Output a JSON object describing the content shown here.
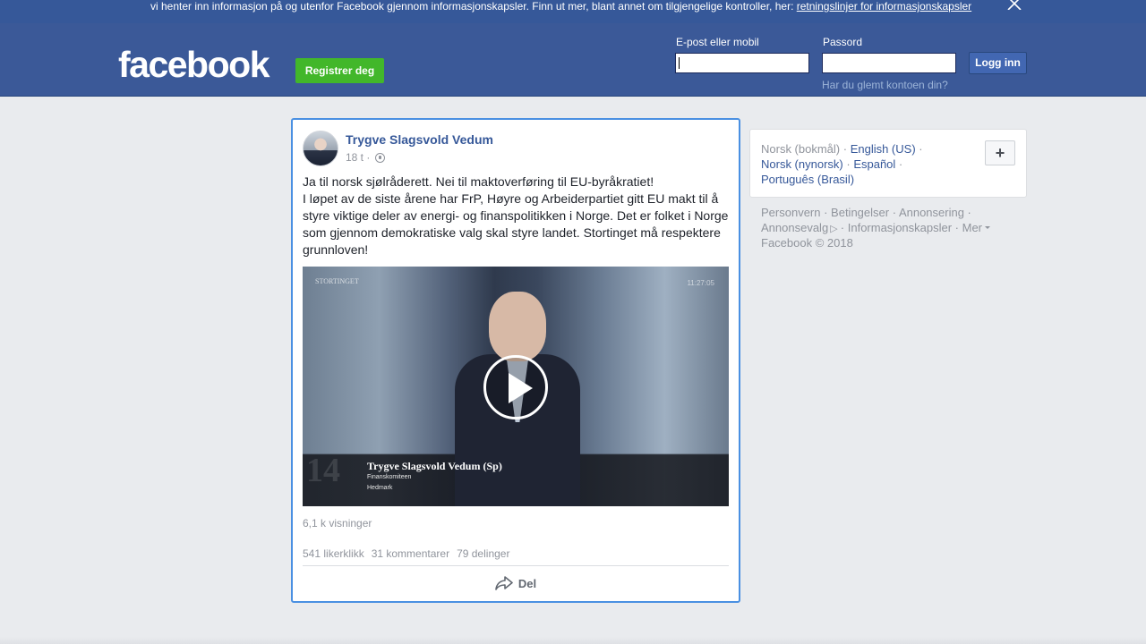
{
  "cookie_banner": {
    "text": "vi henter inn informasjon på og utenfor Facebook gjennom informasjonskapsler. Finn ut mer, blant annet om tilgjengelige kontroller, her: ",
    "link": "retningslinjer for informasjonskapsler"
  },
  "header": {
    "logo": "facebook",
    "register_label": "Registrer deg",
    "email_label": "E-post eller mobil",
    "password_label": "Passord",
    "login_label": "Logg inn",
    "forgot_label": "Har du glemt kontoen din?"
  },
  "post": {
    "author": "Trygve Slagsvold Vedum",
    "time": "18 t ·",
    "text_line1": "Ja til norsk sjølråderett. Nei til maktoverføring til EU-byråkratiet!",
    "text_line2": "I løpet av de siste årene har FrP, Høyre og Arbeiderpartiet gitt EU makt til å styre viktige deler av energi- og finanspolitikken i Norge. Det er folket i Norge som gjennom demokratiske valg skal styre landet. Stortinget må respektere grunnloven!",
    "video": {
      "watermark": "STORTINGET",
      "time": "11:27:05",
      "channel": "14",
      "caption_name": "Trygve Slagsvold Vedum (Sp)",
      "caption_role": "Finanskomiteen",
      "caption_region": "Hedmark"
    },
    "views": "6,1 k visninger",
    "likes": "541 likerklikk",
    "comments": "31 kommentarer",
    "shares": "79 delinger",
    "share_label": "Del"
  },
  "languages": {
    "current": "Norsk (bokmål)",
    "items": [
      "English (US)",
      "Norsk (nynorsk)",
      "Español",
      "Português (Brasil)"
    ],
    "add_label": "+"
  },
  "footer": {
    "links": [
      "Personvern",
      "Betingelser",
      "Annonsering",
      "Annonsevalg",
      "Informasjonskapsler",
      "Mer"
    ],
    "copyright": "Facebook © 2018"
  },
  "colors": {
    "header_bg": "#3b5998",
    "link": "#365899",
    "register_green": "#42b72a",
    "post_focus_border": "#4a90e2"
  }
}
